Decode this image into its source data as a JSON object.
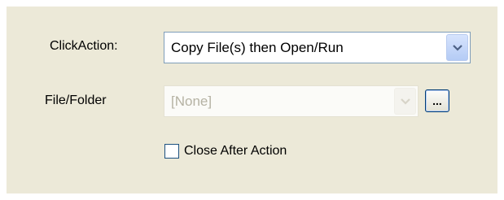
{
  "click_action": {
    "label": "ClickAction:",
    "value": "Copy File(s) then Open/Run"
  },
  "file_folder": {
    "label": "File/Folder",
    "value": "[None]",
    "browse_label": "..."
  },
  "close_after_action": {
    "label": "Close After Action",
    "checked": false
  }
}
